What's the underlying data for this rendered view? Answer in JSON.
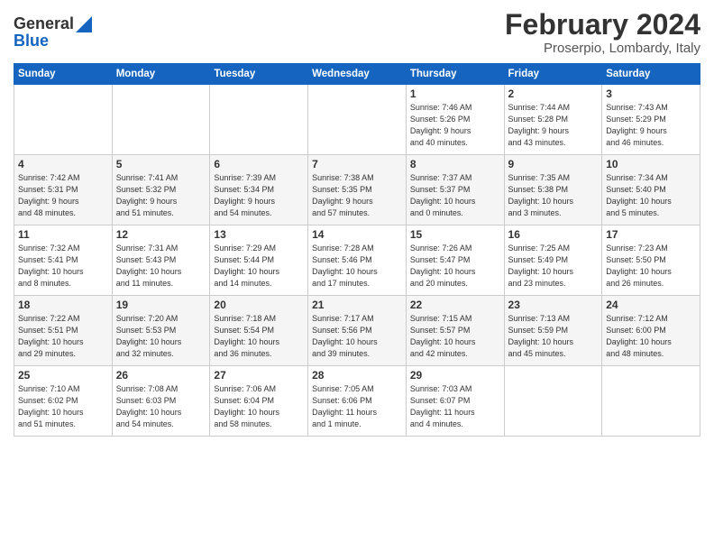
{
  "header": {
    "logo_general": "General",
    "logo_blue": "Blue",
    "title": "February 2024",
    "subtitle": "Proserpio, Lombardy, Italy"
  },
  "days_of_week": [
    "Sunday",
    "Monday",
    "Tuesday",
    "Wednesday",
    "Thursday",
    "Friday",
    "Saturday"
  ],
  "weeks": [
    [
      {
        "day": "",
        "content": ""
      },
      {
        "day": "",
        "content": ""
      },
      {
        "day": "",
        "content": ""
      },
      {
        "day": "",
        "content": ""
      },
      {
        "day": "1",
        "content": "Sunrise: 7:46 AM\nSunset: 5:26 PM\nDaylight: 9 hours\nand 40 minutes."
      },
      {
        "day": "2",
        "content": "Sunrise: 7:44 AM\nSunset: 5:28 PM\nDaylight: 9 hours\nand 43 minutes."
      },
      {
        "day": "3",
        "content": "Sunrise: 7:43 AM\nSunset: 5:29 PM\nDaylight: 9 hours\nand 46 minutes."
      }
    ],
    [
      {
        "day": "4",
        "content": "Sunrise: 7:42 AM\nSunset: 5:31 PM\nDaylight: 9 hours\nand 48 minutes."
      },
      {
        "day": "5",
        "content": "Sunrise: 7:41 AM\nSunset: 5:32 PM\nDaylight: 9 hours\nand 51 minutes."
      },
      {
        "day": "6",
        "content": "Sunrise: 7:39 AM\nSunset: 5:34 PM\nDaylight: 9 hours\nand 54 minutes."
      },
      {
        "day": "7",
        "content": "Sunrise: 7:38 AM\nSunset: 5:35 PM\nDaylight: 9 hours\nand 57 minutes."
      },
      {
        "day": "8",
        "content": "Sunrise: 7:37 AM\nSunset: 5:37 PM\nDaylight: 10 hours\nand 0 minutes."
      },
      {
        "day": "9",
        "content": "Sunrise: 7:35 AM\nSunset: 5:38 PM\nDaylight: 10 hours\nand 3 minutes."
      },
      {
        "day": "10",
        "content": "Sunrise: 7:34 AM\nSunset: 5:40 PM\nDaylight: 10 hours\nand 5 minutes."
      }
    ],
    [
      {
        "day": "11",
        "content": "Sunrise: 7:32 AM\nSunset: 5:41 PM\nDaylight: 10 hours\nand 8 minutes."
      },
      {
        "day": "12",
        "content": "Sunrise: 7:31 AM\nSunset: 5:43 PM\nDaylight: 10 hours\nand 11 minutes."
      },
      {
        "day": "13",
        "content": "Sunrise: 7:29 AM\nSunset: 5:44 PM\nDaylight: 10 hours\nand 14 minutes."
      },
      {
        "day": "14",
        "content": "Sunrise: 7:28 AM\nSunset: 5:46 PM\nDaylight: 10 hours\nand 17 minutes."
      },
      {
        "day": "15",
        "content": "Sunrise: 7:26 AM\nSunset: 5:47 PM\nDaylight: 10 hours\nand 20 minutes."
      },
      {
        "day": "16",
        "content": "Sunrise: 7:25 AM\nSunset: 5:49 PM\nDaylight: 10 hours\nand 23 minutes."
      },
      {
        "day": "17",
        "content": "Sunrise: 7:23 AM\nSunset: 5:50 PM\nDaylight: 10 hours\nand 26 minutes."
      }
    ],
    [
      {
        "day": "18",
        "content": "Sunrise: 7:22 AM\nSunset: 5:51 PM\nDaylight: 10 hours\nand 29 minutes."
      },
      {
        "day": "19",
        "content": "Sunrise: 7:20 AM\nSunset: 5:53 PM\nDaylight: 10 hours\nand 32 minutes."
      },
      {
        "day": "20",
        "content": "Sunrise: 7:18 AM\nSunset: 5:54 PM\nDaylight: 10 hours\nand 36 minutes."
      },
      {
        "day": "21",
        "content": "Sunrise: 7:17 AM\nSunset: 5:56 PM\nDaylight: 10 hours\nand 39 minutes."
      },
      {
        "day": "22",
        "content": "Sunrise: 7:15 AM\nSunset: 5:57 PM\nDaylight: 10 hours\nand 42 minutes."
      },
      {
        "day": "23",
        "content": "Sunrise: 7:13 AM\nSunset: 5:59 PM\nDaylight: 10 hours\nand 45 minutes."
      },
      {
        "day": "24",
        "content": "Sunrise: 7:12 AM\nSunset: 6:00 PM\nDaylight: 10 hours\nand 48 minutes."
      }
    ],
    [
      {
        "day": "25",
        "content": "Sunrise: 7:10 AM\nSunset: 6:02 PM\nDaylight: 10 hours\nand 51 minutes."
      },
      {
        "day": "26",
        "content": "Sunrise: 7:08 AM\nSunset: 6:03 PM\nDaylight: 10 hours\nand 54 minutes."
      },
      {
        "day": "27",
        "content": "Sunrise: 7:06 AM\nSunset: 6:04 PM\nDaylight: 10 hours\nand 58 minutes."
      },
      {
        "day": "28",
        "content": "Sunrise: 7:05 AM\nSunset: 6:06 PM\nDaylight: 11 hours\nand 1 minute."
      },
      {
        "day": "29",
        "content": "Sunrise: 7:03 AM\nSunset: 6:07 PM\nDaylight: 11 hours\nand 4 minutes."
      },
      {
        "day": "",
        "content": ""
      },
      {
        "day": "",
        "content": ""
      }
    ]
  ]
}
